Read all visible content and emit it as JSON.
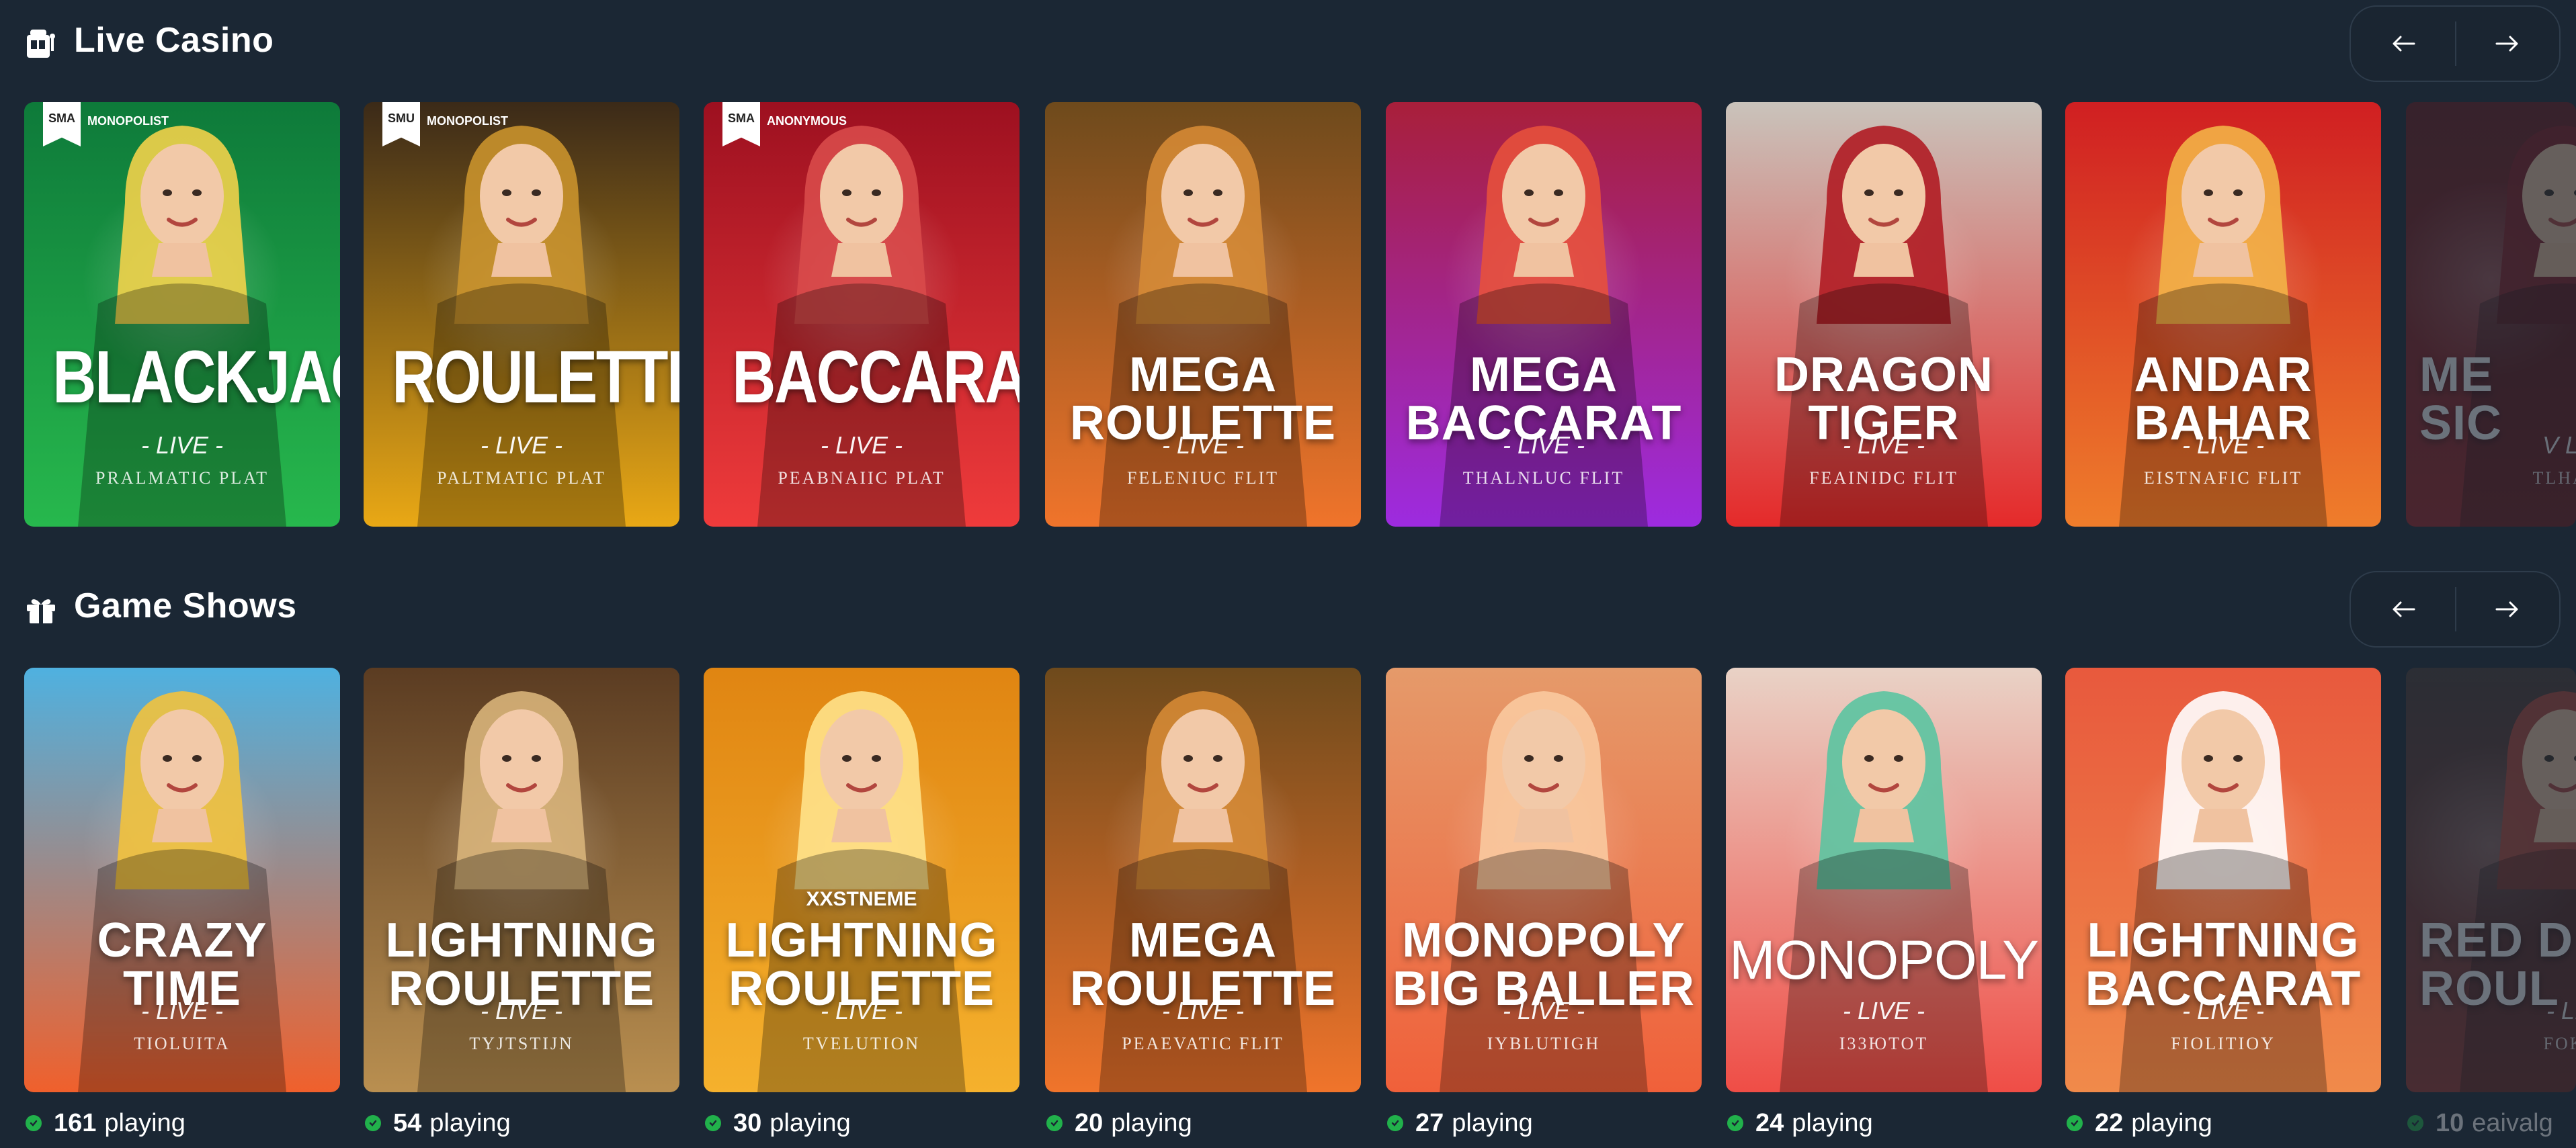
{
  "sections": [
    {
      "title": "Live Casino",
      "icon": "slot-machine-icon",
      "prev_icon": "arrow-left-icon",
      "next_icon": "arrow-right-icon",
      "cards": [
        {
          "title": "BLACKJACK",
          "subtitle": "- LIVE -",
          "provider": "PRALMATIC PLAT",
          "logo": "SMA",
          "logo_text": "MONOPOLIST",
          "bg_top": "#0e7a3a",
          "bg_bottom": "#27b84d",
          "accent": "#f2d24a"
        },
        {
          "title": "ROULETTE",
          "subtitle": "- LIVE -",
          "provider": "PALTMATIC PLAT",
          "logo": "SMU",
          "logo_text": "MONOPOLIST",
          "bg_top": "#3b2a18",
          "bg_bottom": "#e9a815",
          "accent": "#c9922c"
        },
        {
          "title": "BACCARAT",
          "subtitle": "- LIVE -",
          "provider": "PEABNAIIC PLAT",
          "logo": "SMA",
          "logo_text": "ANONYMOUS",
          "bg_top": "#9d1020",
          "bg_bottom": "#ef3b3b",
          "accent": "#d84a4a"
        },
        {
          "title": "MEGA\nROULETTE",
          "subtitle": "- LIVE -",
          "provider": "FELENIUC FLIT",
          "bg_top": "#6e4a1c",
          "bg_bottom": "#f0742b",
          "accent": "#d58a35"
        },
        {
          "title": "MEGA\nBACCARAT",
          "subtitle": "- LIVE -",
          "provider": "THALNLUC FLIT",
          "bg_top": "#a81f3a",
          "bg_bottom": "#9d2be0",
          "accent": "#e7503c"
        },
        {
          "title": "DRAGON\nTIGER",
          "subtitle": "- LIVE -",
          "provider": "FEAINIDC FLIT",
          "bg_top": "#c9c3bb",
          "bg_bottom": "#e52a2a",
          "accent": "#b01c23"
        },
        {
          "title": "ANDAR\nBAHAR",
          "subtitle": "- LIVE -",
          "provider": "EISTNAFIC FLIT",
          "bg_top": "#d01f22",
          "bg_bottom": "#ef7d2b",
          "accent": "#f3b347"
        },
        {
          "title": "ME\nSIC",
          "subtitle": "V LI",
          "provider": "TLHAI",
          "bg_top": "#6b1b1e",
          "bg_bottom": "#a12326",
          "accent": "#8a1c22"
        }
      ]
    },
    {
      "title": "Game Shows",
      "icon": "gift-icon",
      "prev_icon": "arrow-left-icon",
      "next_icon": "arrow-right-icon",
      "cards": [
        {
          "title": "CRAZY\nTIME",
          "subtitle": "- LIVE -",
          "provider": "TIOLUITA",
          "players_count": "161",
          "players_label": "playing",
          "bg_top": "#4fb1e0",
          "bg_bottom": "#f0602c",
          "accent": "#f2c23d"
        },
        {
          "title": "LIGHTNING\nROULETTE",
          "subtitle": "- LIVE -",
          "provider": "TYJTSTIJN",
          "players_count": "54",
          "players_label": "playing",
          "bg_top": "#5b3c22",
          "bg_bottom": "#b98f50",
          "accent": "#d8b47a"
        },
        {
          "title": "LIGHTNING\nROULETTE",
          "pre_title": "XXSTNEME",
          "subtitle": "- LIVE -",
          "provider": "TVELUTION",
          "players_count": "30",
          "players_label": "playing",
          "bg_top": "#e08512",
          "bg_bottom": "#f5b12d",
          "accent": "#ffe28a"
        },
        {
          "title": "MEGA\nROULETTE",
          "subtitle": "- LIVE -",
          "provider": "PEAEVATIC FLIT",
          "players_count": "20",
          "players_label": "playing",
          "bg_top": "#6e4a1c",
          "bg_bottom": "#f0742b",
          "accent": "#d58a35"
        },
        {
          "title": "MONOPOLY\nBIG BALLER",
          "subtitle": "- LIVE -",
          "provider": "IYBLUTIGH",
          "players_count": "27",
          "players_label": "playing",
          "bg_top": "#e59a6a",
          "bg_bottom": "#f0603a",
          "accent": "#f9c99e"
        },
        {
          "title": "MONOPOLY",
          "subtitle": "- LIVE -",
          "provider": "I33ЮTOT",
          "players_count": "24",
          "players_label": "playing",
          "bg_top": "#e9d2c6",
          "bg_bottom": "#ef4d46",
          "accent": "#5bc4a1"
        },
        {
          "title": "LIGHTNING\nBACCARAT",
          "subtitle": "- LIVE -",
          "provider": "FIOLITIOY",
          "players_count": "22",
          "players_label": "playing",
          "bg_top": "#e8593d",
          "bg_bottom": "#f08a4a",
          "accent": "#ffffff"
        },
        {
          "title": "RED D\nROUL",
          "subtitle": "- LI",
          "provider": "FOK",
          "players_count": "10",
          "players_label": "eaivalg",
          "bg_top": "#4b3a36",
          "bg_bottom": "#9c3730",
          "accent": "#c24a3c"
        }
      ]
    }
  ]
}
